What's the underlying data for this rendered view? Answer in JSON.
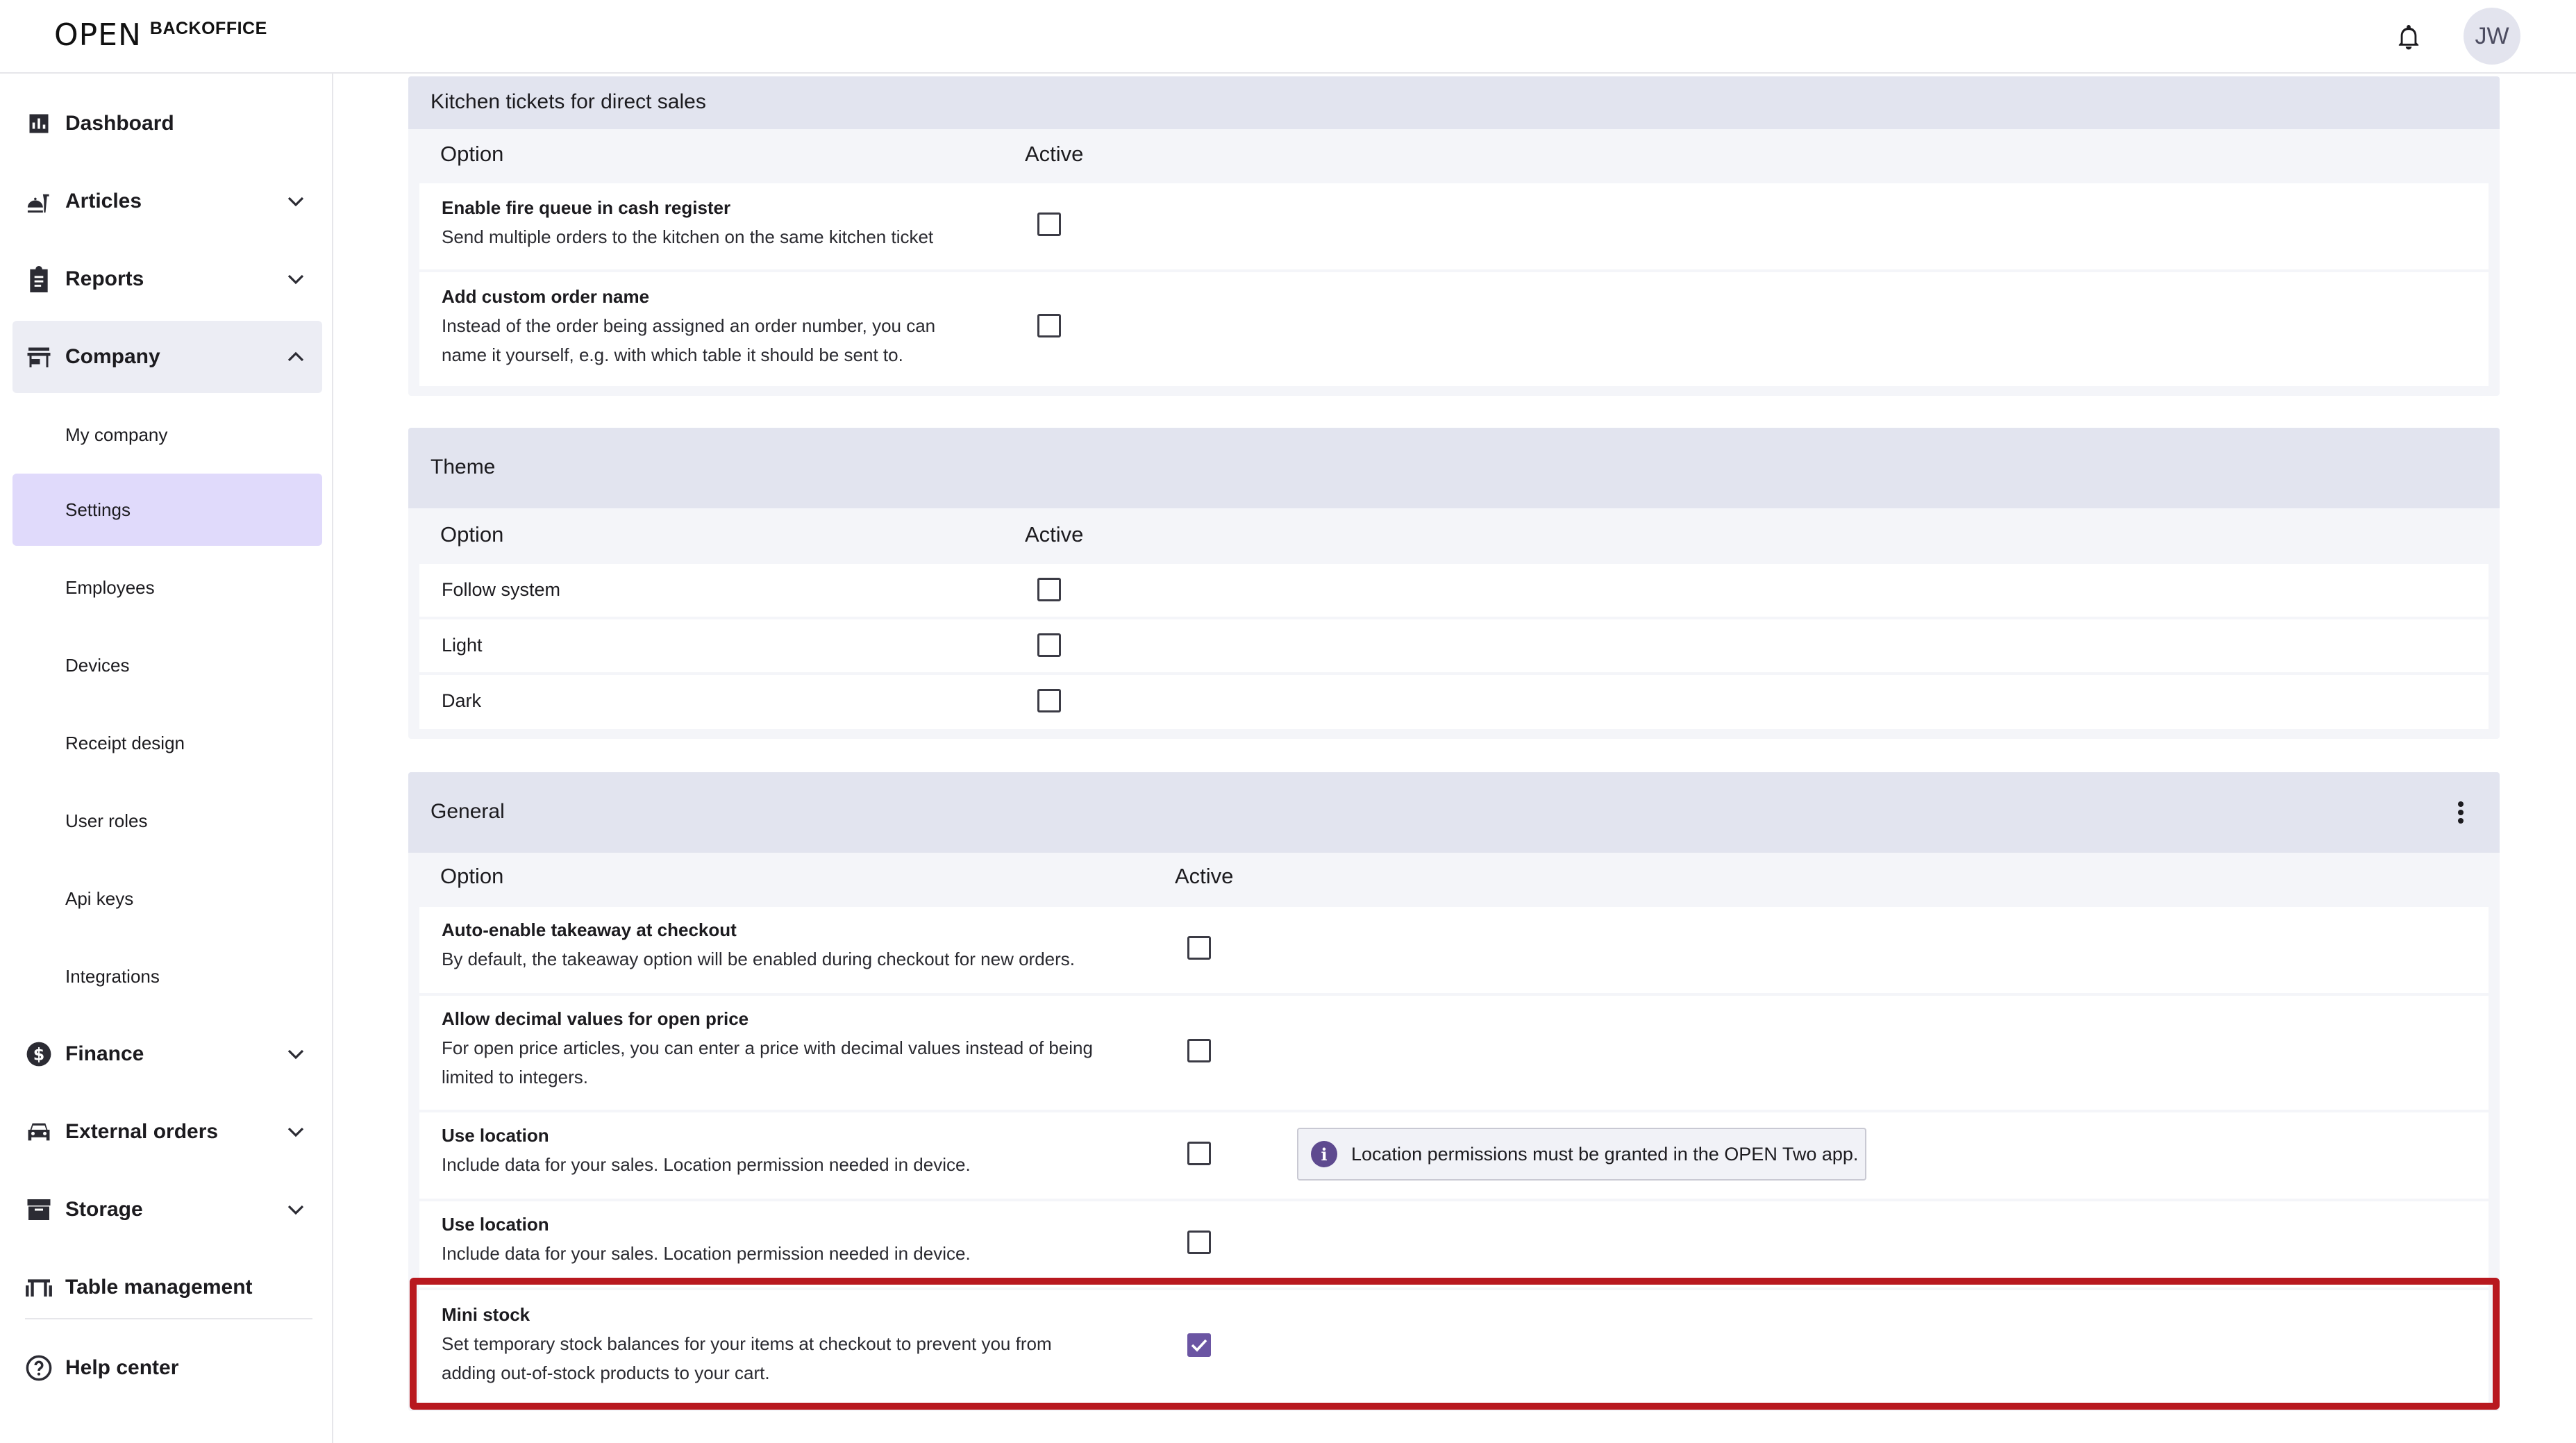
{
  "header": {
    "logo_mark": "OPEN",
    "logo_text": "BACKOFFICE",
    "bell_icon": "bell-icon",
    "avatar_initials": "JW"
  },
  "sidebar": {
    "items": [
      {
        "label": "Dashboard",
        "icon": "dashboard-icon"
      },
      {
        "label": "Articles",
        "icon": "articles-icon"
      },
      {
        "label": "Reports",
        "icon": "reports-icon"
      },
      {
        "label": "Company",
        "icon": "company-icon"
      },
      {
        "label": "Finance",
        "icon": "finance-icon"
      },
      {
        "label": "External orders",
        "icon": "car-icon"
      },
      {
        "label": "Storage",
        "icon": "storage-icon"
      },
      {
        "label": "Table management",
        "icon": "table-icon"
      },
      {
        "label": "Help center",
        "icon": "help-icon"
      }
    ],
    "company_sub": [
      {
        "label": "My company"
      },
      {
        "label": "Settings"
      },
      {
        "label": "Employees"
      },
      {
        "label": "Devices"
      },
      {
        "label": "Receipt design"
      },
      {
        "label": "User roles"
      },
      {
        "label": "Api keys"
      },
      {
        "label": "Integrations"
      }
    ]
  },
  "kitchen": {
    "title": "Kitchen tickets for direct sales",
    "col_option": "Option",
    "col_active": "Active",
    "rows": [
      {
        "title": "Enable fire queue in cash register",
        "desc1": "Send multiple orders to the kitchen on the same kitchen ticket",
        "checked": false
      },
      {
        "title": "Add custom order name",
        "desc1": "Instead of the order being assigned an order number, you can",
        "desc2": "name it yourself, e.g. with which table it should be sent to.",
        "checked": false
      }
    ]
  },
  "theme": {
    "title": "Theme",
    "col_option": "Option",
    "col_active": "Active",
    "rows": [
      {
        "label": "Follow system",
        "checked": false
      },
      {
        "label": "Light",
        "checked": false
      },
      {
        "label": "Dark",
        "checked": false
      }
    ]
  },
  "general": {
    "title": "General",
    "col_option": "Option",
    "col_active": "Active",
    "rows": [
      {
        "title": "Auto-enable takeaway at checkout",
        "desc1": "By default, the takeaway option will be enabled during checkout for new orders.",
        "checked": false
      },
      {
        "title": "Allow decimal values for open price",
        "desc1": "For open price articles, you can enter a price with decimal values instead of being",
        "desc2": "limited to integers.",
        "checked": false
      },
      {
        "title": "Use location",
        "desc1": "Include data for your sales. Location permission needed in device.",
        "checked": false
      },
      {
        "title": "Use location",
        "desc1": "Include data for your sales. Location permission needed in device.",
        "checked": false
      },
      {
        "title": "Mini stock",
        "desc1": "Set temporary stock balances for your items at checkout to prevent you from",
        "desc2": "adding out-of-stock products to your cart.",
        "checked": true
      }
    ],
    "info_note": "Location permissions must be granted in the OPEN Two app."
  },
  "colors": {
    "accent": "#6b55a3",
    "highlight": "#b8181f",
    "active_nav": "#e0dafb"
  }
}
